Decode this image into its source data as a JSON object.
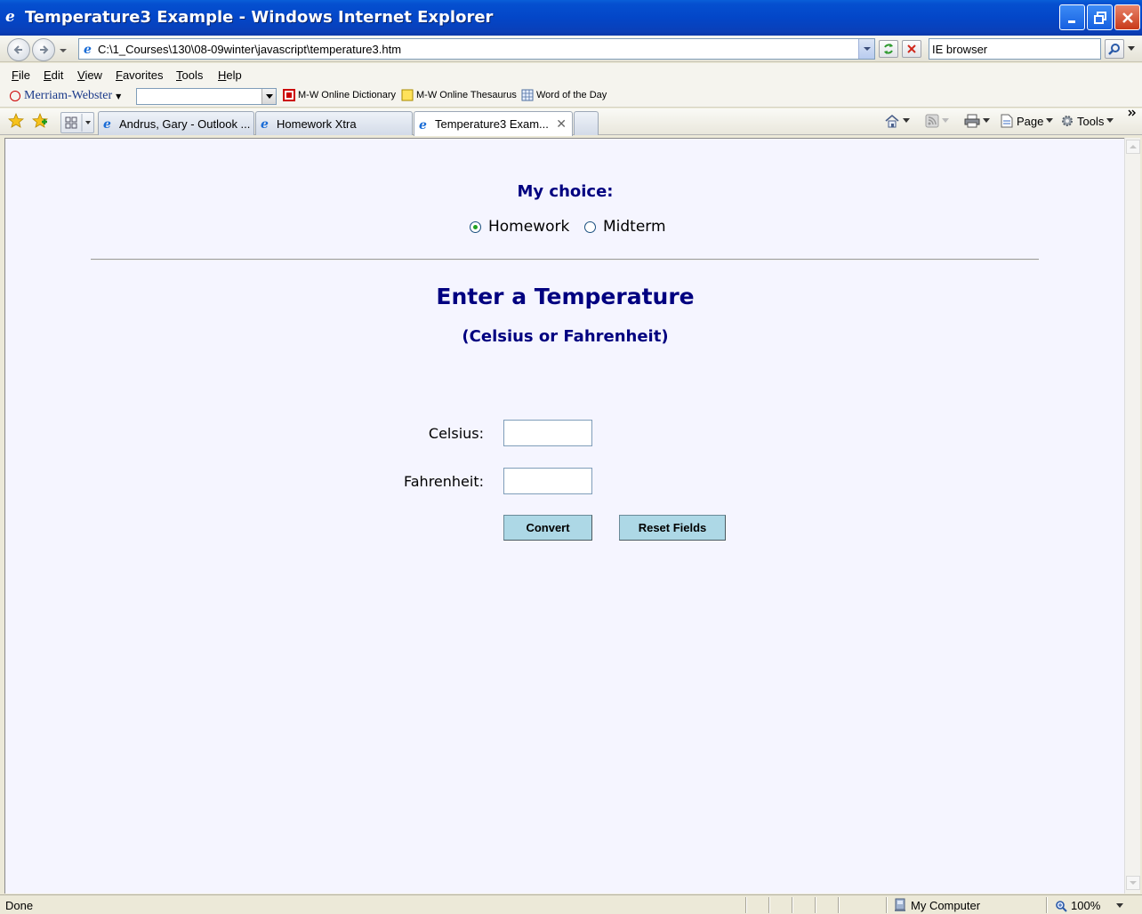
{
  "window": {
    "title": "Temperature3 Example - Windows Internet Explorer"
  },
  "address_bar": {
    "url": "C:\\1_Courses\\130\\08-09winter\\javascript\\temperature3.htm",
    "search_value": "IE browser"
  },
  "menu": {
    "items": [
      "File",
      "Edit",
      "View",
      "Favorites",
      "Tools",
      "Help"
    ]
  },
  "links_bar": {
    "brand": "Merriam-Webster",
    "links": [
      "M-W Online Dictionary",
      "M-W Online Thesaurus",
      "Word of the Day"
    ]
  },
  "tabs": [
    {
      "label": "Andrus, Gary - Outlook ...",
      "active": false
    },
    {
      "label": "Homework Xtra",
      "active": false
    },
    {
      "label": "Temperature3 Exam...",
      "active": true
    }
  ],
  "commands": {
    "page": "Page",
    "tools": "Tools"
  },
  "page": {
    "choice_heading": "My choice:",
    "choices": [
      {
        "label": "Homework",
        "checked": true
      },
      {
        "label": "Midterm",
        "checked": false
      }
    ],
    "heading": "Enter a Temperature",
    "subheading": "(Celsius or Fahrenheit)",
    "fields": [
      {
        "label": "Celsius:",
        "value": ""
      },
      {
        "label": "Fahrenheit:",
        "value": ""
      }
    ],
    "buttons": {
      "convert": "Convert",
      "reset": "Reset Fields"
    }
  },
  "status_bar": {
    "status": "Done",
    "zone": "My Computer",
    "zoom": "100%"
  },
  "colors": {
    "heading": "#000080",
    "button": "#add8e6",
    "page_background": "#f5f5ff"
  }
}
